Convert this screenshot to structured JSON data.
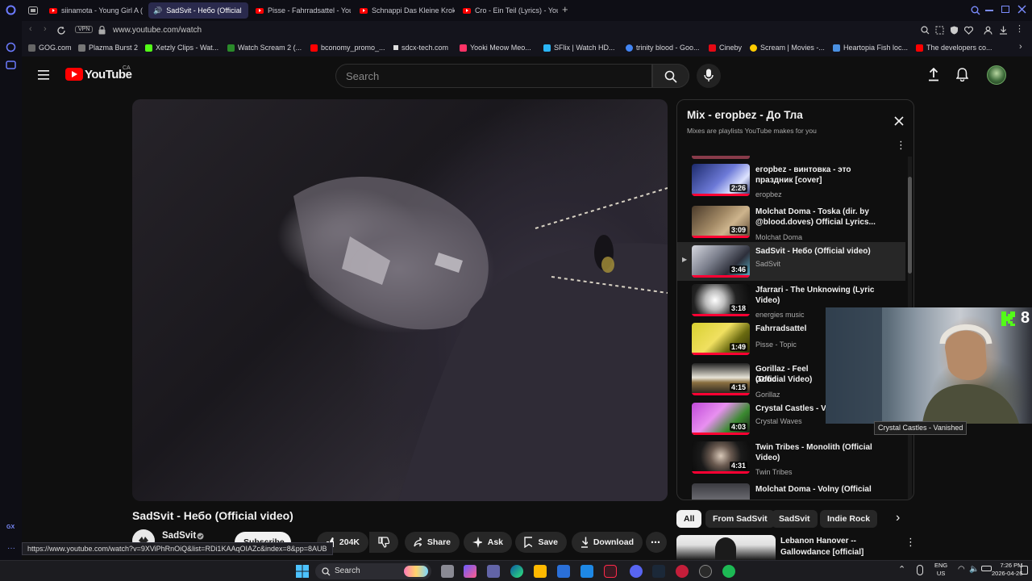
{
  "browser": {
    "tabs": [
      {
        "label": "siinamota - Young Girl A (",
        "active": false
      },
      {
        "label": "SadSvit - Небо (Official",
        "active": true
      },
      {
        "label": "Pisse - Fahrradsattel - You",
        "active": false
      },
      {
        "label": "Schnappi Das Kleine Krok",
        "active": false
      },
      {
        "label": "Cro - Ein Teil (Lyrics) - You",
        "active": false
      }
    ],
    "new_tab": "+",
    "vpn_label": "VPN",
    "url": "www.youtube.com/watch",
    "bookmarks": [
      {
        "label": "GOG.com",
        "color": "#666666"
      },
      {
        "label": "Plazma Burst 2",
        "color": "#777777"
      },
      {
        "label": "Xetzly Clips - Wat...",
        "color": "#53fc18"
      },
      {
        "label": "Watch Scream 2 (...",
        "color": "#2a8a2a"
      },
      {
        "label": "bconomy_promo_...",
        "color": "#ff0000"
      },
      {
        "label": "sdcx-tech.com",
        "color": "#dddddd"
      },
      {
        "label": "Yooki Meow Meo...",
        "color": "#ff3366"
      },
      {
        "label": "SFlix | Watch HD...",
        "color": "#2ab5f5"
      },
      {
        "label": "trinity blood - Goo...",
        "color": "#4285f4"
      },
      {
        "label": "Cineby",
        "color": "#e50914"
      },
      {
        "label": "Scream | Movies -...",
        "color": "#ffcc00"
      },
      {
        "label": "Heartopia Fish loc...",
        "color": "#4a90e2"
      },
      {
        "label": "The developers co...",
        "color": "#ff0000"
      }
    ],
    "sidebar_label": "GX"
  },
  "youtube": {
    "logo_text": "YouTube",
    "region": "CA",
    "search_placeholder": "Search",
    "video_title": "SadSvit - Небо (Official video)",
    "channel": "SadSvit",
    "subscribe_label": "Subscribe",
    "likes": "204K",
    "actions": [
      "Share",
      "Ask",
      "Save",
      "Download"
    ],
    "chips": [
      "All",
      "From SadSvit",
      "SadSvit",
      "Indie Rock"
    ],
    "rec": {
      "title_1": "Lebanon Hanover --",
      "title_2": "Gallowdance [official]"
    }
  },
  "mix": {
    "title": "Mix - егорbez - До Тла",
    "subtitle": "Mixes are playlists YouTube makes for you",
    "items": [
      {
        "title": "егорbez - винтовка - это праздник [cover]",
        "channel": "егорbez",
        "duration": "2:26"
      },
      {
        "title": "Molchat Doma - Toska (dir. by @blood.doves) Official Lyrics...",
        "channel": "Molchat Doma",
        "duration": "3:09"
      },
      {
        "title": "SadSvit - Небо (Official video)",
        "channel": "SadSvit",
        "duration": "3:46",
        "playing": true
      },
      {
        "title": "Jfarrari - The Unknowing (Lyric Video)",
        "channel": "energies music",
        "duration": "3:18"
      },
      {
        "title": "Fahrradsattel",
        "channel": "Pisse - Topic",
        "duration": "1:49"
      },
      {
        "title": "Gorillaz - Feel Good Inc. (Official Video)",
        "channel": "Gorillaz",
        "duration": "4:15"
      },
      {
        "title": "Crystal Castles - Vanished",
        "channel": "Crystal Waves",
        "duration": "4:03"
      },
      {
        "title": "Twin Tribes - Monolith (Official Video)",
        "channel": "Twin Tribes",
        "duration": "4:31"
      },
      {
        "title": "Molchat Doma - Volny (Official Lyric Video)",
        "channel": "",
        "duration": ""
      }
    ],
    "item_titles_visible": [
      "егорbez - винтовка - это праздник [cover]",
      "Molchat Doma - Toska (dir. by @blood.doves) Official Lyrics...",
      "SadSvit - Небо (Official video)",
      "Jfarrari - The Unknowing (Lyric Video)",
      "Fahrradsattel",
      "Gorillaz - Feel Good",
      "Crystal Castles - Va",
      "Twin Tribes - Monolith (Official Video)",
      "Molchat Doma - Volny (Official"
    ]
  },
  "overlay": {
    "tooltip": "Crystal Castles - Vanished",
    "kick_number": "8",
    "status_url": "https://www.youtube.com/watch?v=9XViPhRnOiQ&list=RDi1KAAqOIAZc&index=8&pp=8AUB"
  },
  "taskbar": {
    "search": "Search",
    "lang": "ENG",
    "region": "US",
    "time": "7:26 PM",
    "date": "2026-04-26"
  }
}
